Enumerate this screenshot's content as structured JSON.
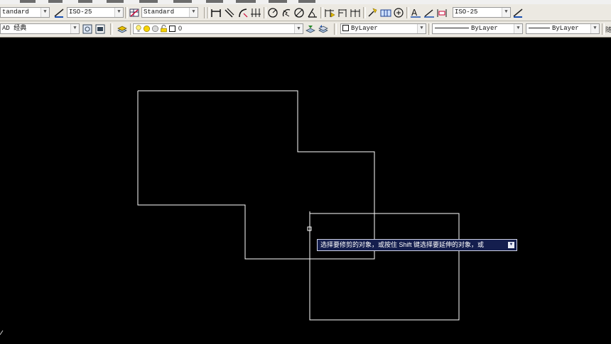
{
  "menubar": {
    "note": ""
  },
  "styles_toolbar": {
    "text_style": "tandard",
    "dim_style": "ISO-25",
    "table_style": "Standard",
    "dim_style_2": "ISO-25"
  },
  "workspace_toolbar": {
    "workspace": "AD 经典",
    "layer_name": "0",
    "color": "ByLayer",
    "linetype": "ByLayer",
    "lineweight": "ByLayer",
    "right_edge": "随"
  },
  "drawing": {
    "tooltip": "选择要修剪的对象，或按住 Shift 键选择要延伸的对象，或",
    "stroke_color": "#ffffff"
  },
  "icons": [
    "style-icon",
    "dimension-icon",
    "linear-dim-icon",
    "aligned-dim-icon",
    "arc-dim-icon",
    "ordinate-dim-icon",
    "radius-icon",
    "jogged-icon",
    "diameter-icon",
    "angular-icon",
    "quick-dim-icon",
    "baseline-icon",
    "continue-icon",
    "quick-leader-icon",
    "tolerance-icon",
    "center-mark-icon",
    "dim-edit-icon",
    "dim-text-edit-icon",
    "dim-update-icon",
    "layer-manager-icon",
    "layer-state-icon",
    "make-current-icon",
    "layer-previous-icon"
  ]
}
